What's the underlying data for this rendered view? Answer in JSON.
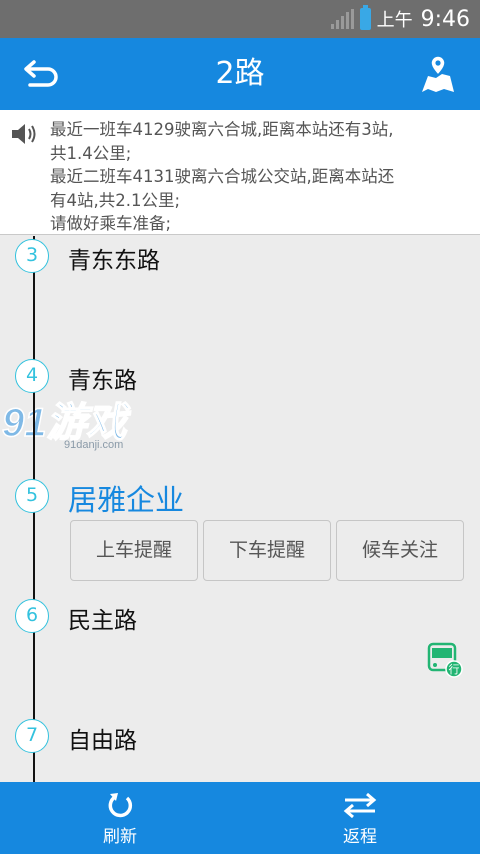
{
  "status_bar": {
    "ampm": "上午",
    "time": "9:46"
  },
  "header": {
    "title": "2路"
  },
  "notice": {
    "lines": [
      "最近一班车4129驶离六合城,距离本站还有3站,",
      "共1.4公里;",
      "最近二班车4131驶离六合城公交站,距离本站还",
      "有4站,共2.1公里;",
      "请做好乘车准备;"
    ]
  },
  "stations": [
    {
      "number": "3",
      "name": "青东东路"
    },
    {
      "number": "4",
      "name": "青东路"
    },
    {
      "number": "5",
      "name": "居雅企业"
    },
    {
      "number": "6",
      "name": "民主路"
    },
    {
      "number": "7",
      "name": "自由路"
    }
  ],
  "actions": [
    "上车提醒",
    "下车提醒",
    "候车关注"
  ],
  "bus_badge": "行",
  "watermark": {
    "big": "91游戏",
    "small": "91danji.com"
  },
  "bottom_bar": {
    "refresh_label": "刷新",
    "return_label": "返程"
  },
  "colors": {
    "primary": "#1688df",
    "station_ring": "#33c2de",
    "bus_green": "#22b573"
  }
}
